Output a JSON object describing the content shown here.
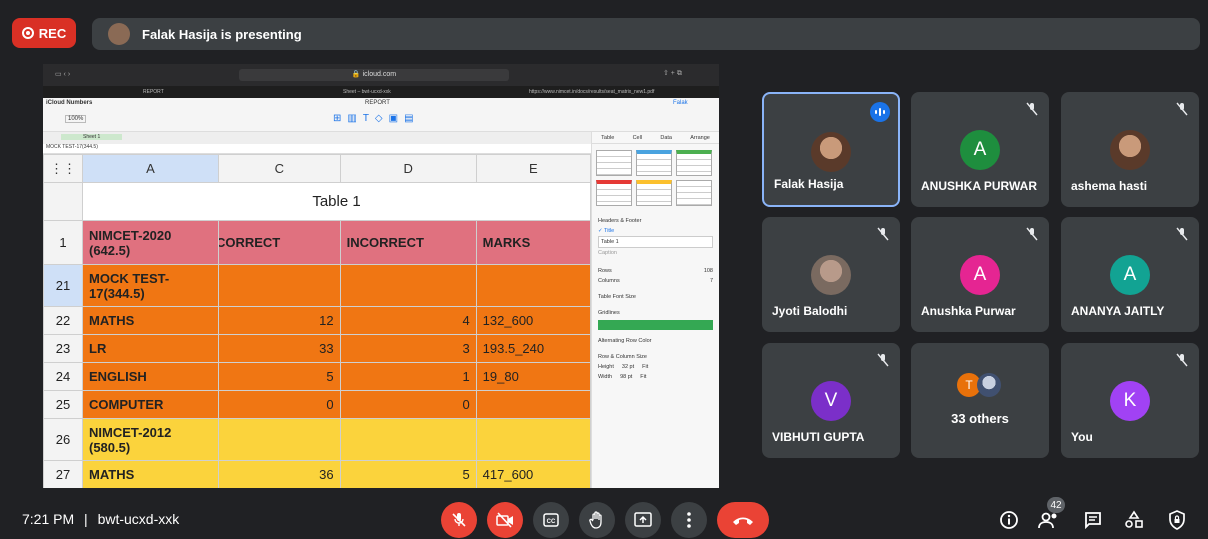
{
  "top": {
    "rec_label": "REC",
    "presenting": "Falak Hasija is presenting"
  },
  "browser": {
    "url": "icloud.com",
    "tabs": [
      "REPORT",
      "Sheet – bwt-ucxd-xxk",
      "https://www.nimcet.in/docs/results/seat_matrix_new1.pdf"
    ]
  },
  "numbers": {
    "app": "iCloud Numbers",
    "doc_title": "REPORT",
    "zoom": "100%",
    "user": "Falak",
    "sheet_tab": "Sheet 1",
    "cell_ref": "MOCK TEST-17(344.5)"
  },
  "sheet": {
    "columns": [
      "A",
      "C",
      "D",
      "E"
    ],
    "table_title": "Table 1",
    "header": {
      "row": "1",
      "a": "NIMCET-2020 (642.5)",
      "c": "CORRECT",
      "d": "INCORRECT",
      "e": "MARKS"
    },
    "rows": [
      {
        "row": "21",
        "a": "MOCK TEST-17(344.5)",
        "c": "",
        "d": "",
        "e": ""
      },
      {
        "row": "22",
        "a": "MATHS",
        "c": "12",
        "d": "4",
        "e": "132_600"
      },
      {
        "row": "23",
        "a": "LR",
        "c": "33",
        "d": "3",
        "e": "193.5_240"
      },
      {
        "row": "24",
        "a": "ENGLISH",
        "c": "5",
        "d": "1",
        "e": "19_80"
      },
      {
        "row": "25",
        "a": "COMPUTER",
        "c": "0",
        "d": "0",
        "e": ""
      },
      {
        "row": "26",
        "a": "NIMCET-2012 (580.5)",
        "c": "",
        "d": "",
        "e": ""
      },
      {
        "row": "27",
        "a": "MATHS",
        "c": "36",
        "d": "5",
        "e": "417_600"
      }
    ]
  },
  "panel": {
    "tabs": [
      "Table",
      "Cell",
      "Data",
      "Arrange"
    ],
    "headers_footer": "Headers & Footer",
    "title_check": "Title",
    "title_value": "Table 1",
    "caption": "Caption",
    "rows_label": "Rows",
    "rows_val": "108",
    "cols_label": "Columns",
    "cols_val": "7",
    "font_size": "Table Font Size",
    "gridlines": "Gridlines",
    "alt_rows": "Alternating Row Color",
    "rc_size": "Row & Column Size",
    "height_label": "Height",
    "height_val": "32 pt",
    "width_label": "Width",
    "width_val": "98 pt",
    "fit": "Fit"
  },
  "participants": [
    {
      "name": "Falak Hasija",
      "initial": "",
      "color": ""
    },
    {
      "name": "ANUSHKA PURWAR",
      "initial": "A",
      "color": "#1e8e3e"
    },
    {
      "name": "ashema hasti",
      "initial": "",
      "color": ""
    },
    {
      "name": "Jyoti Balodhi",
      "initial": "",
      "color": ""
    },
    {
      "name": "Anushka Purwar",
      "initial": "A",
      "color": "#e52592"
    },
    {
      "name": "ANANYA JAITLY",
      "initial": "A",
      "color": "#12a393"
    },
    {
      "name": "VIBHUTI GUPTA",
      "initial": "V",
      "color": "#7b2fc9"
    },
    {
      "name": "33 others",
      "initial": "T",
      "color": "#e8710a"
    },
    {
      "name": "You",
      "initial": "K",
      "color": "#a142f4"
    }
  ],
  "bottom": {
    "time": "7:21 PM",
    "separator": "|",
    "meeting_code": "bwt-ucxd-xxk",
    "people_count": "42"
  }
}
